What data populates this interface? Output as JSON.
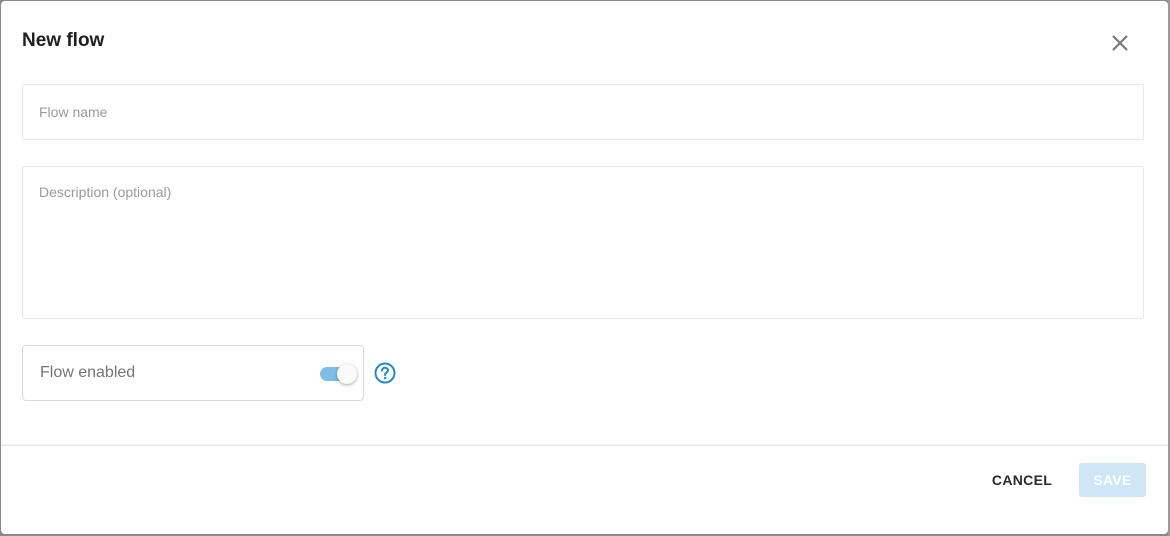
{
  "dialog": {
    "title": "New flow",
    "close_icon": "close-icon"
  },
  "form": {
    "flow_name": {
      "value": "",
      "placeholder": "Flow name"
    },
    "description": {
      "value": "",
      "placeholder": "Description (optional)"
    },
    "flow_enabled": {
      "label": "Flow enabled",
      "checked": true
    },
    "help_icon": "help-circle-icon"
  },
  "footer": {
    "cancel_label": "CANCEL",
    "save_label": "SAVE",
    "save_enabled": false
  },
  "colors": {
    "accent": "#1e88c9",
    "switch_track_on": "#7dbfe8",
    "save_disabled_bg": "#cfe6f6",
    "save_disabled_text": "#ffffff"
  }
}
